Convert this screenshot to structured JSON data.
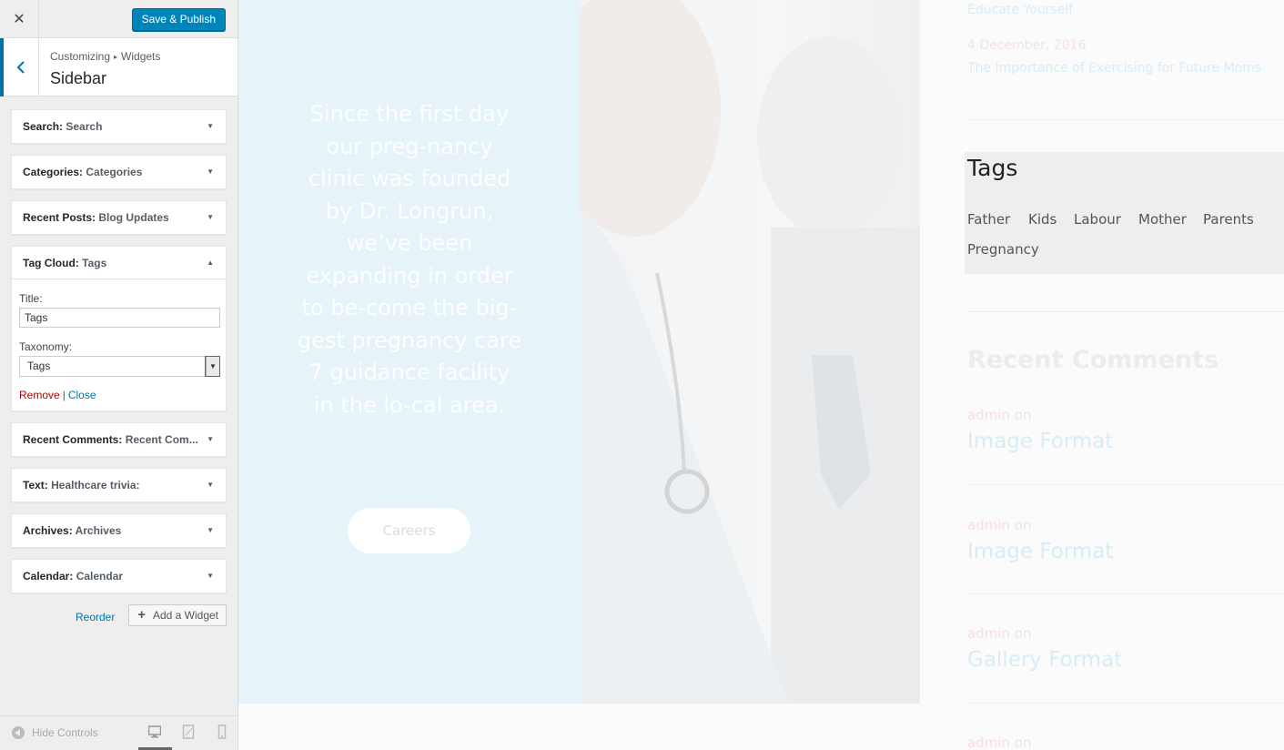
{
  "topbar": {
    "close_icon": "✕",
    "publish_label": "Save & Publish"
  },
  "section": {
    "crumb_root": "Customizing",
    "crumb_sep": "▸",
    "crumb_leaf": "Widgets",
    "title": "Sidebar"
  },
  "widgets": [
    {
      "type": "Search",
      "title": "Search"
    },
    {
      "type": "Categories",
      "title": "Categories"
    },
    {
      "type": "Recent Posts",
      "title": "Blog Updates"
    },
    {
      "type": "Tag Cloud",
      "title": "Tags"
    },
    {
      "type": "Recent Comments",
      "title": "Recent Com..."
    },
    {
      "type": "Text",
      "title": "Healthcare trivia:"
    },
    {
      "type": "Archives",
      "title": "Archives"
    },
    {
      "type": "Calendar",
      "title": "Calendar"
    }
  ],
  "colon": ":",
  "tagcloud_form": {
    "title_label": "Title:",
    "title_value": "Tags",
    "taxonomy_label": "Taxonomy:",
    "taxonomy_value": "Tags",
    "remove_label": "Remove",
    "separator": "|",
    "close_label": "Close"
  },
  "actions": {
    "reorder_label": "Reorder",
    "add_widget_label": "Add a Widget",
    "plus": "+"
  },
  "footer": {
    "hide_controls_label": "Hide Controls",
    "active_device": "desktop"
  },
  "preview": {
    "hero_quote": "Since the first day our preg-nancy clinic was founded by Dr. Longrun, we’ve been expanding in order to be-come the big-gest pregnancy care 7 guidance facility in the lo-cal area.",
    "careers_label": "Careers",
    "recent_posts": {
      "top_link": "Educate Yourself",
      "date": "4 December, 2016",
      "link": "The Importance of Exercising for Future Moms"
    },
    "tags_title": "Tags",
    "tags": [
      "Father",
      "Kids",
      "Labour",
      "Mother",
      "Parents",
      "Pregnancy"
    ],
    "recent_comments_title": "Recent Comments",
    "comments": [
      {
        "author": "admin",
        "on": "on",
        "post": "Image Format"
      },
      {
        "author": "admin",
        "on": "on",
        "post": "Image Format"
      },
      {
        "author": "admin",
        "on": "on",
        "post": "Gallery Format"
      },
      {
        "author": "admin",
        "on": "on",
        "post": ""
      }
    ]
  },
  "colors": {
    "accent": "#0085ba",
    "link": "#0073aa",
    "remove": "#aa0000"
  }
}
